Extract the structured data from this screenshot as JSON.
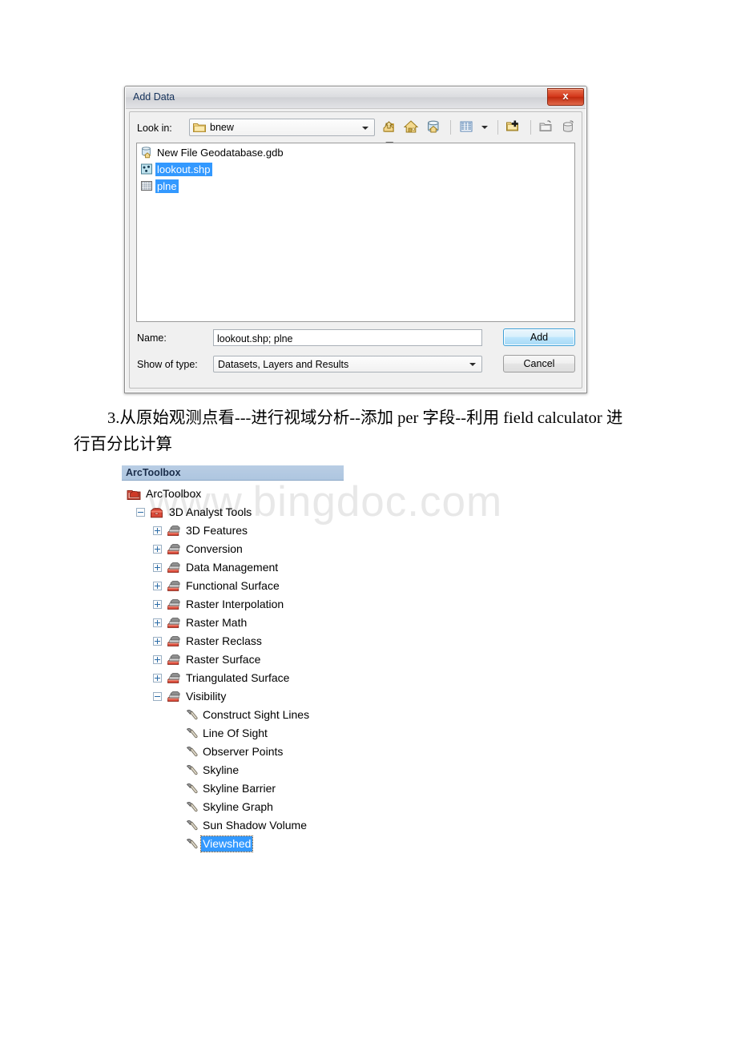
{
  "watermark": {
    "text": "www.bingdoc.com"
  },
  "dialog": {
    "title": "Add Data",
    "close_label": "x",
    "lookin": {
      "label": "Look in:",
      "value": "bnew",
      "icon": "folder-icon"
    },
    "toolbar": [
      {
        "name": "up-one-level-icon",
        "tooltip": "Up One Level"
      },
      {
        "name": "home-icon",
        "tooltip": "Home"
      },
      {
        "name": "default-database-icon",
        "tooltip": "Default Database"
      },
      {
        "name": "list-view-icon",
        "tooltip": "List View"
      },
      {
        "name": "list-view-dropdown-icon",
        "tooltip": "View Menu"
      },
      {
        "name": "connect-to-folder-icon",
        "tooltip": "Connect To Folder"
      },
      {
        "name": "new-folder-icon",
        "tooltip": "New Folder"
      },
      {
        "name": "new-geodatabase-icon",
        "tooltip": "New File Geodatabase"
      },
      {
        "name": "new-toolbox-icon",
        "tooltip": "New Toolbox"
      }
    ],
    "files": [
      {
        "label": "New File Geodatabase.gdb",
        "icon": "geodatabase-icon",
        "selected": false
      },
      {
        "label": "lookout.shp",
        "icon": "point-shapefile-icon",
        "selected": true
      },
      {
        "label": "plne",
        "icon": "raster-icon",
        "selected": true
      }
    ],
    "name_field": {
      "label": "Name:",
      "value": "lookout.shp; plne"
    },
    "type_field": {
      "label": "Show of type:",
      "value": "Datasets, Layers and Results"
    },
    "add_button": "Add",
    "cancel_button": "Cancel"
  },
  "paragraph": {
    "line1": "3.从原始观测点看---进行视域分析--添加 per 字段--利用 field",
    "line2": "calculator 进行百分比计算"
  },
  "arctoolbox": {
    "panel_title": "ArcToolbox",
    "tree": [
      {
        "label": "ArcToolbox",
        "level": 0,
        "icon": "arctoolbox-root-icon",
        "toggle": "none",
        "selected": false
      },
      {
        "label": "3D Analyst Tools",
        "level": 1,
        "icon": "toolbox-icon",
        "toggle": "minus",
        "selected": false
      },
      {
        "label": "3D Features",
        "level": 2,
        "icon": "toolset-icon",
        "toggle": "plus",
        "selected": false
      },
      {
        "label": "Conversion",
        "level": 2,
        "icon": "toolset-icon",
        "toggle": "plus",
        "selected": false
      },
      {
        "label": "Data Management",
        "level": 2,
        "icon": "toolset-icon",
        "toggle": "plus",
        "selected": false
      },
      {
        "label": "Functional Surface",
        "level": 2,
        "icon": "toolset-icon",
        "toggle": "plus",
        "selected": false
      },
      {
        "label": "Raster Interpolation",
        "level": 2,
        "icon": "toolset-icon",
        "toggle": "plus",
        "selected": false
      },
      {
        "label": "Raster Math",
        "level": 2,
        "icon": "toolset-icon",
        "toggle": "plus",
        "selected": false
      },
      {
        "label": "Raster Reclass",
        "level": 2,
        "icon": "toolset-icon",
        "toggle": "plus",
        "selected": false
      },
      {
        "label": "Raster Surface",
        "level": 2,
        "icon": "toolset-icon",
        "toggle": "plus",
        "selected": false
      },
      {
        "label": "Triangulated Surface",
        "level": 2,
        "icon": "toolset-icon",
        "toggle": "plus",
        "selected": false
      },
      {
        "label": "Visibility",
        "level": 2,
        "icon": "toolset-icon",
        "toggle": "minus",
        "selected": false
      },
      {
        "label": "Construct Sight Lines",
        "level": 3,
        "icon": "tool-hammer-icon",
        "toggle": "none",
        "selected": false
      },
      {
        "label": "Line Of Sight",
        "level": 3,
        "icon": "tool-hammer-icon",
        "toggle": "none",
        "selected": false
      },
      {
        "label": "Observer Points",
        "level": 3,
        "icon": "tool-hammer-icon",
        "toggle": "none",
        "selected": false
      },
      {
        "label": "Skyline",
        "level": 3,
        "icon": "tool-hammer-icon",
        "toggle": "none",
        "selected": false
      },
      {
        "label": "Skyline Barrier",
        "level": 3,
        "icon": "tool-hammer-icon",
        "toggle": "none",
        "selected": false
      },
      {
        "label": "Skyline Graph",
        "level": 3,
        "icon": "tool-hammer-icon",
        "toggle": "none",
        "selected": false
      },
      {
        "label": "Sun Shadow Volume",
        "level": 3,
        "icon": "tool-hammer-icon",
        "toggle": "none",
        "selected": false
      },
      {
        "label": "Viewshed",
        "level": 3,
        "icon": "tool-hammer-icon",
        "toggle": "none",
        "selected": true
      }
    ]
  },
  "colors": {
    "selection_blue": "#3399ff",
    "panel_header": "#aec6e0",
    "close_red": "#d4371b",
    "watermark_gray": "#e8e8e8"
  }
}
